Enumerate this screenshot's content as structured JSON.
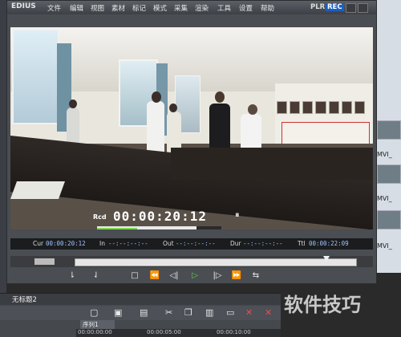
{
  "app": {
    "name": "EDIUS"
  },
  "menu": [
    "文件",
    "编辑",
    "视图",
    "素材",
    "标记",
    "模式",
    "采集",
    "渲染",
    "工具",
    "设置",
    "帮助"
  ],
  "player": {
    "plr_label": "PLR",
    "rec_label": "REC"
  },
  "timecode": {
    "label": "Rcd",
    "value": "00:00:20:12",
    "pause_symbol": "⏸",
    "progress": 0.8
  },
  "status": {
    "cur_label": "Cur",
    "cur_value": "00:00:20:12",
    "in_label": "In",
    "in_value": "--:--:--:--",
    "out_label": "Out",
    "out_value": "--:--:--:--",
    "dur_label": "Dur",
    "dur_value": "--:--:--:--",
    "ttl_label": "Ttl",
    "ttl_value": "00:00:22:09"
  },
  "transport": {
    "set_in": "⇂",
    "set_out": "⇃",
    "stop": "□",
    "rewind": "⏪",
    "prev_frame": "◁|",
    "play": "▷",
    "next_frame": "|▷",
    "fast_forward": "⏩",
    "loop": "⇆"
  },
  "timeline": {
    "project_name": "无标题2",
    "sequence_tab": "序列1",
    "ruler": [
      "00:00:00:00",
      "00:00:05:00",
      "00:00:10:00"
    ]
  },
  "desktop": {
    "thumb_labels": [
      "MVI_",
      "MVI_",
      "MVI_"
    ]
  },
  "watermark": "软件技巧",
  "colors": {
    "rec_active": "#1c5fbf",
    "play_icon": "#5fd04a",
    "title_bg": "#4a4d52"
  }
}
